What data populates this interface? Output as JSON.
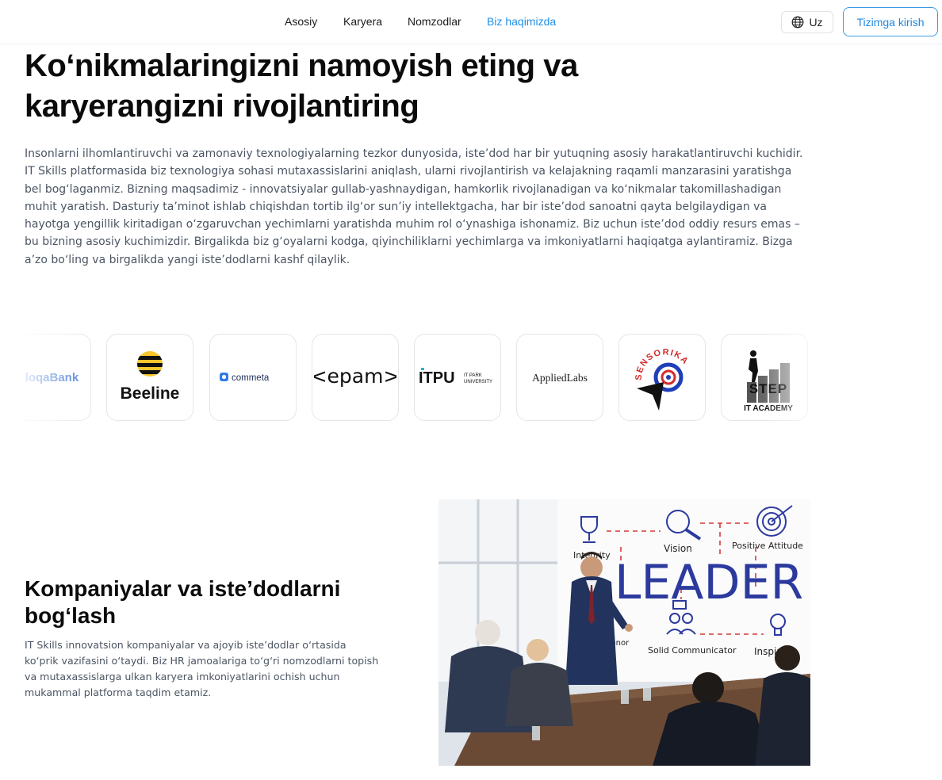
{
  "nav": {
    "items": [
      "Asosiy",
      "Karyera",
      "Nomzodlar",
      "Biz haqimizda"
    ],
    "active": "Biz haqimizda",
    "accent": "#1e90e8"
  },
  "header": {
    "lang_label": "Uz",
    "lang_icon": "globe-icon",
    "login_label": "Tizimga kirish"
  },
  "hero": {
    "title_line1": "Ko‘nikmalaringizni namoyish eting va",
    "title_line2": "karyerangizni rivojlantiring",
    "paragraph": "Insonlarni ilhomlantiruvchi va zamonaviy texnologiyalarning tezkor dunyosida, iste’dod har bir yutuqning asosiy harakatlantiruvchi kuchidir. IT Skills platformasida biz texnologiya sohasi mutaxassislarini aniqlash, ularni rivojlantirish va kelajakning raqamli manzarasini yaratishga bel bog‘laganmiz. Bizning maqsadimiz - innovatsiyalar gullab-yashnaydigan, hamkorlik rivojlanadigan va ko‘nikmalar takomillashadigan muhit yaratish. Dasturiy ta’minot ishlab chiqishdan tortib ilg‘or sun’iy intellektgacha, har bir iste’dod sanoatni qayta belgilaydigan va hayotga yengillik kiritadigan o‘zgaruvchan yechimlarni yaratishda muhim rol o‘ynashiga ishonamiz. Biz uchun iste’dod oddiy resurs emas – bu bizning asosiy kuchimizdir. Birgalikda biz g‘oyalarni kodga, qiyinchiliklarni yechimlarga va imkoniyatlarni haqiqatga aylantiramiz. Bizga a’zo bo‘ling va birgalikda yangi iste’dodlarni kashf qilaylik."
  },
  "partners": {
    "aloqabank": "AloqaBank",
    "beeline": "Beeline",
    "commeta": "commeta",
    "epam": "<epam>",
    "itpu": "ITPU",
    "itpu_sub1": "IT PARK",
    "itpu_sub2": "UNIVERSITY",
    "appliedlabs": "AppliedLabs",
    "sensorika": "SENSORIKA",
    "step_word": "STEP",
    "step_sub": "IT ACADEMY"
  },
  "section2": {
    "title_line1": "Kompaniyalar va iste’dodlarni",
    "title_line2": "bog‘lash",
    "paragraph": "IT Skills innovatsion kompaniyalar va ajoyib iste’dodlar o‘rtasida ko‘prik vazifasini o‘taydi. Biz HR jamoalariga to‘g‘ri nomzodlarni topish va mutaxassislarga ulkan karyera imkoniyatlarini ochish uchun mukammal platforma taqdim etamiz."
  },
  "photo": {
    "board_word": "LEADER",
    "labels": [
      "Integrity",
      "Vision",
      "Positive Attitude",
      "Solid Communicator",
      "Inspiring",
      "Honor"
    ],
    "board_ink": "#2c3a9e",
    "board_red": "#d43a3a"
  }
}
